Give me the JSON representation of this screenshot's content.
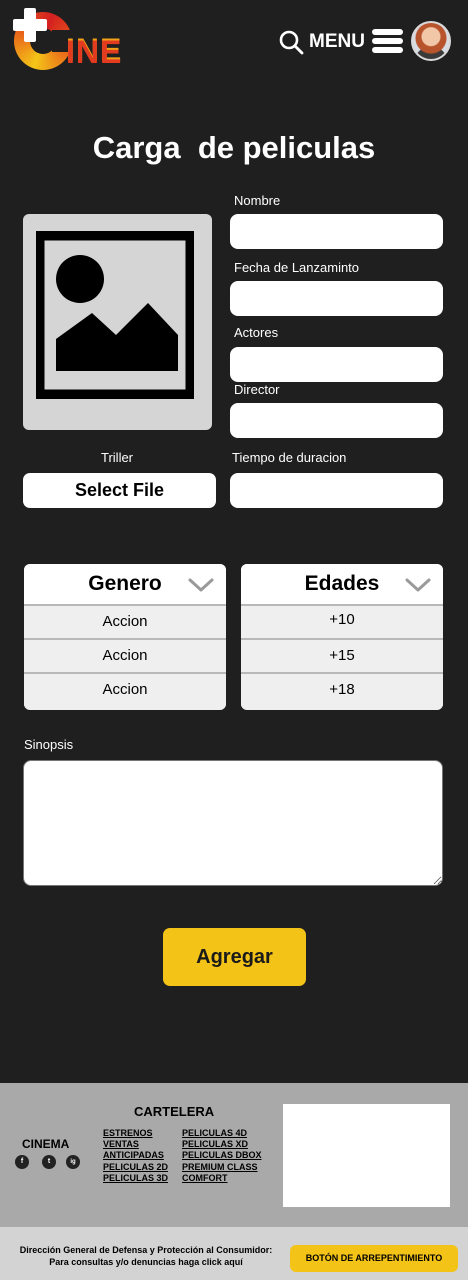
{
  "header": {
    "logo_text": "INE",
    "menu_label": "MENU",
    "icons": {
      "search": "search-icon",
      "menu": "hamburger-icon",
      "avatar": "user-avatar"
    }
  },
  "page": {
    "title": "Carga  de peliculas"
  },
  "form": {
    "nombre_label": "Nombre",
    "fecha_label": "Fecha de Lanzaminto",
    "actores_label": "Actores",
    "director_label": "Director",
    "trailer_label": "Triller",
    "select_file_label": "Select File",
    "duracion_label": "Tiempo de duracion",
    "sinopsis_label": "Sinopsis",
    "nombre_value": "",
    "fecha_value": "",
    "actores_value": "",
    "director_value": "",
    "duracion_value": "",
    "sinopsis_value": ""
  },
  "genero": {
    "title": "Genero",
    "options": [
      "Accion",
      "Accion",
      "Accion"
    ]
  },
  "edades": {
    "title": "Edades",
    "options": [
      "+10",
      "+15",
      "+18"
    ]
  },
  "actions": {
    "add_label": "Agregar"
  },
  "footer": {
    "cinema_label": "CINEMA",
    "cartelera_title": "CARTELERA",
    "links_col1": [
      "ESTRENOS",
      "VENTAS",
      "ANTICIPADAS",
      "PELICULAS 2D",
      "PELICULAS 3D"
    ],
    "links_col2": [
      "PELICULAS 4D",
      "PELICULAS XD",
      "PELICULAS DBOX",
      "PREMIUM CLASS",
      "COMFORT"
    ],
    "social": [
      "f",
      "t",
      "ig"
    ],
    "consumer_line1": "Dirección General de Defensa y Protección al Consumidor:",
    "consumer_line2": "Para consultas y/o denuncias haga click aquí",
    "regret_button": "BOTÓN DE ARREPENTIMIENTO"
  },
  "colors": {
    "background": "#1f1f1f",
    "accent": "#f3c318",
    "footer": "#a9a9a9"
  }
}
